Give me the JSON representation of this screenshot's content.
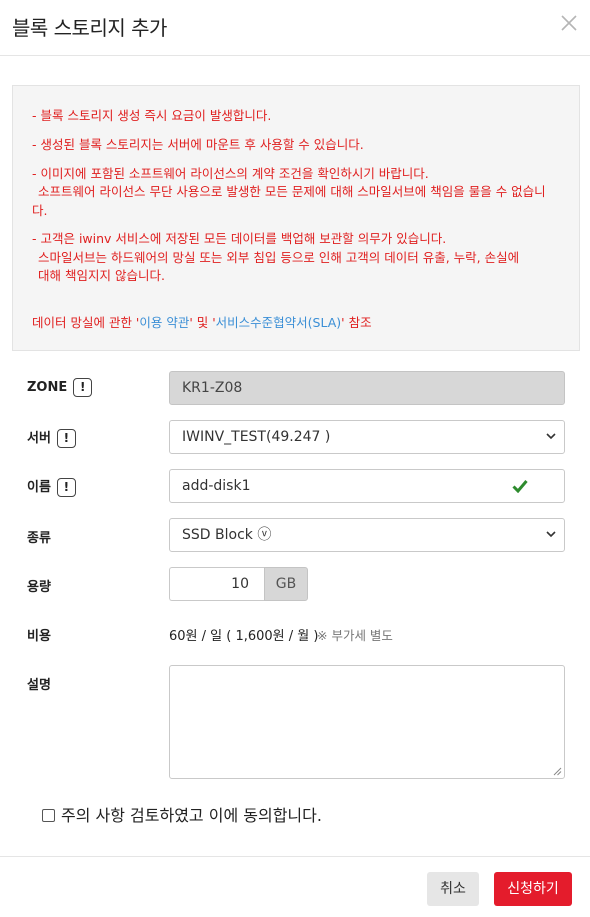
{
  "dialog": {
    "title": "블록 스토리지 추가",
    "close_icon": "close-icon"
  },
  "notice": {
    "lines": [
      "- 블록 스토리지 생성 즉시 요금이 발생합니다.",
      "- 생성된 블록 스토리지는 서버에 마운트 후 사용할 수 있습니다.",
      "- 이미지에 포함된 소프트웨어 라이선스의 계약 조건을 확인하시기 바랍니다.",
      "소프트웨어 라이선스 무단 사용으로 발생한 모든 문제에 대해 스마일서브에 책임을 물을 수 없습니",
      "다.",
      "- 고객은 iwinv 서비스에 저장된 모든 데이터를 백업해 보관할 의무가 있습니다.",
      "스마일서브는 하드웨어의 망실 또는 외부 침입 등으로 인해 고객의 데이터 유출, 누락, 손실에",
      "대해 책임지지 않습니다."
    ],
    "footer_prefix": "데이터 망실에 관한 '",
    "terms_link": "이용 약관",
    "footer_mid": "' 및 '",
    "sla_link": "서비스수준협약서(SLA)",
    "footer_suffix": "' 참조"
  },
  "form": {
    "warn_glyph": "!",
    "zone": {
      "label": "ZONE",
      "value": "KR1-Z08"
    },
    "server": {
      "label": "서버",
      "value": "IWINV_TEST(49.247              )"
    },
    "name": {
      "label": "이름",
      "value": "add-disk1"
    },
    "type": {
      "label": "종류",
      "value": "SSD Block ⓥ"
    },
    "capacity": {
      "label": "용량",
      "value": "10",
      "unit": "GB"
    },
    "cost": {
      "label": "비용",
      "value": "60원 / 일 ( 1,600원 / 월 )",
      "note": "※ 부가세 별도"
    },
    "description": {
      "label": "설명",
      "value": ""
    }
  },
  "agreement": {
    "label": "주의 사항 검토하였고 이에 동의합니다."
  },
  "buttons": {
    "cancel": "취소",
    "submit": "신청하기"
  },
  "colors": {
    "warning_text": "#e02020",
    "link": "#3b8fd6",
    "primary": "#e41c2c",
    "valid_check": "#2e8b2e"
  }
}
